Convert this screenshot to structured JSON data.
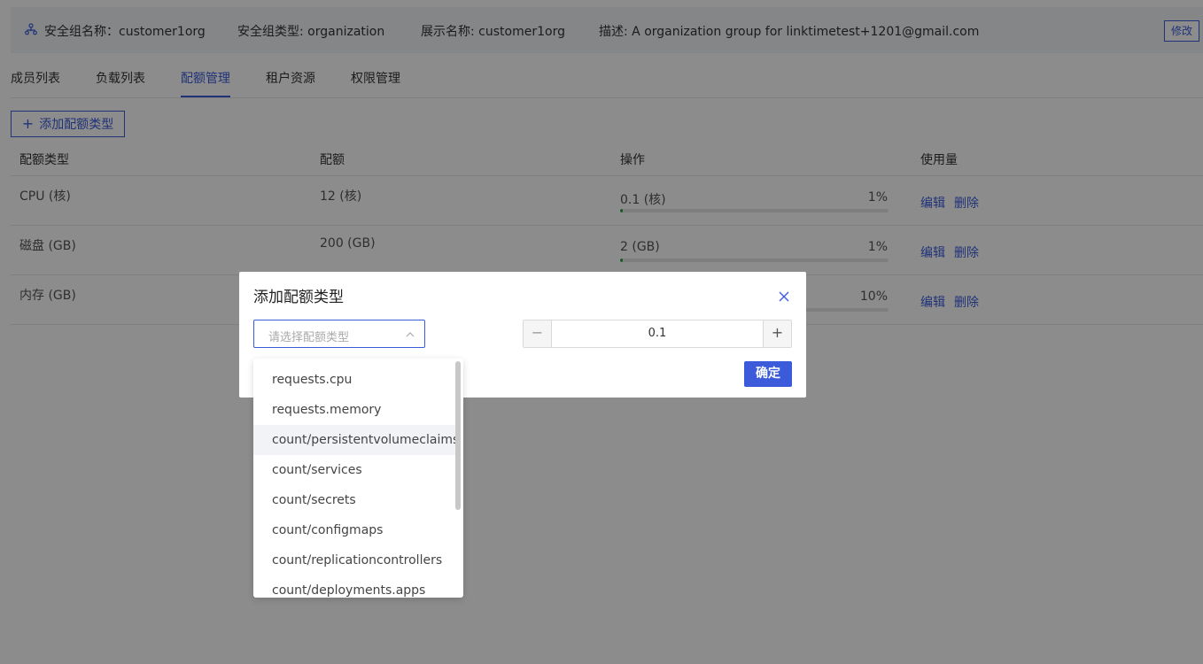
{
  "info": {
    "group_name": "安全组名称：customer1org",
    "group_type": "安全组类型: organization",
    "display_name": "展示名称: customer1org",
    "description": "描述: A organization group for linktimetest+1201@gmail.com",
    "edit_label": "修改"
  },
  "tabs": [
    {
      "label": "成员列表",
      "active": false
    },
    {
      "label": "负载列表",
      "active": false
    },
    {
      "label": "配额管理",
      "active": true
    },
    {
      "label": "租户资源",
      "active": false
    },
    {
      "label": "权限管理",
      "active": false
    }
  ],
  "add_button": {
    "icon": "+",
    "label": "添加配额类型"
  },
  "table": {
    "headers": [
      "配额类型",
      "配额",
      "操作",
      "使用量"
    ],
    "rows": [
      {
        "type": "CPU (核)",
        "quota": "12 (核)",
        "used": "0.1 (核)",
        "percent": "1%",
        "fraction": 0.01,
        "edit": "编辑",
        "delete": "删除"
      },
      {
        "type": "磁盘 (GB)",
        "quota": "200 (GB)",
        "used": "2 (GB)",
        "percent": "1%",
        "fraction": 0.01,
        "edit": "编辑",
        "delete": "删除"
      },
      {
        "type": "内存 (GB)",
        "quota": "",
        "used": "",
        "percent": "10%",
        "fraction": 0.1,
        "edit": "编辑",
        "delete": "删除"
      }
    ]
  },
  "modal": {
    "title": "添加配额类型",
    "select_placeholder": "请选择配额类型",
    "stepper_value": "0.1",
    "minus": "−",
    "plus": "+",
    "confirm": "确定"
  },
  "dropdown": {
    "options": [
      "requests.cpu",
      "requests.memory",
      "count/persistentvolumeclaims",
      "count/services",
      "count/secrets",
      "count/configmaps",
      "count/replicationcontrollers",
      "count/deployments.apps"
    ],
    "hover_index": 2
  },
  "colors": {
    "accent": "#3b5bdb",
    "progress": "#27a844"
  }
}
